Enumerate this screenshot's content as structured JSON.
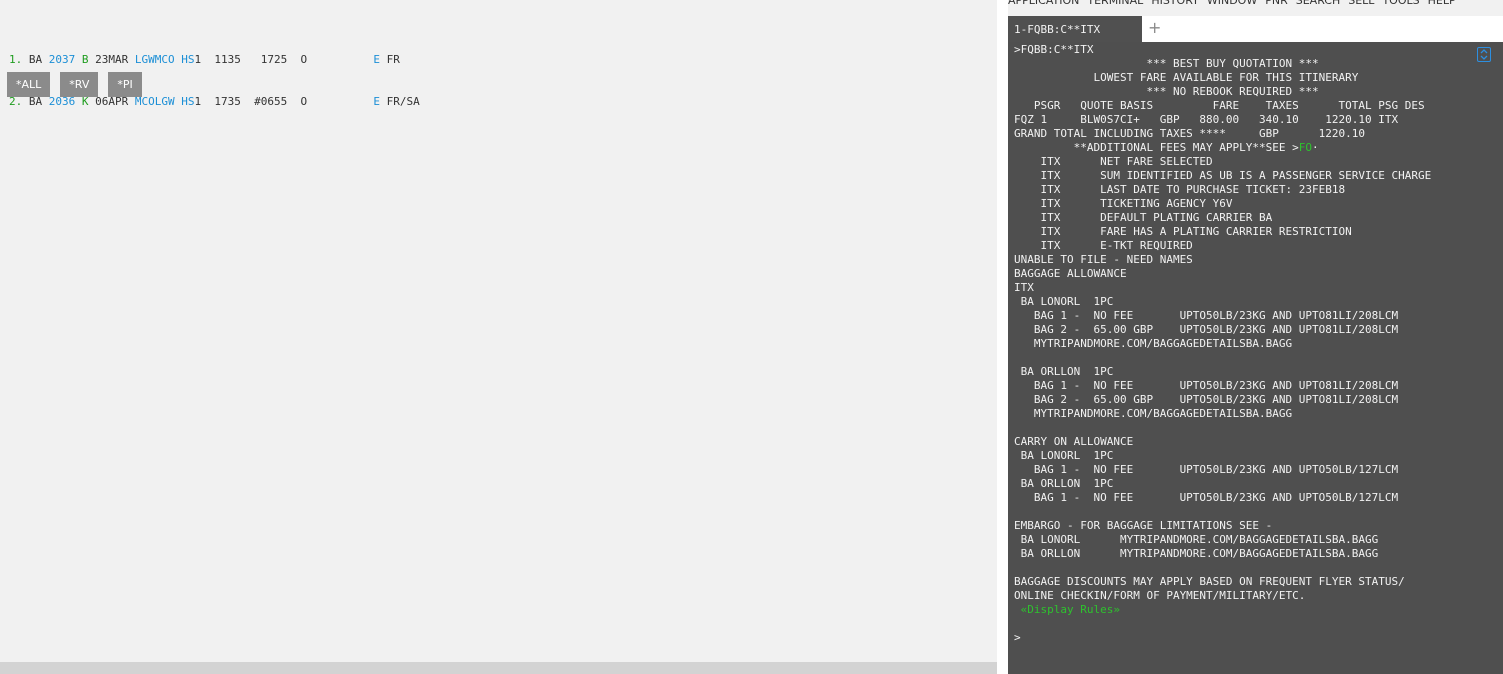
{
  "menubar": [
    "APPLICATION",
    "TERMINAL",
    "HISTORY",
    "WINDOW",
    "PNR",
    "SEARCH",
    "SELL",
    "TOOLS",
    "HELP"
  ],
  "itinerary": [
    {
      "num": "1.",
      "airline": "BA",
      "flight": "2037",
      "class": "B",
      "date": "23MAR",
      "route": "LGWMCO",
      "status": "HS",
      "qty": "1",
      "dep": "1135",
      "arr": "1725",
      "flag": "O",
      "eticket": "E",
      "days": "FR"
    },
    {
      "num": "2.",
      "airline": "BA",
      "flight": "2036",
      "class": "K",
      "date": "06APR",
      "route": "MCOLGW",
      "status": "HS",
      "qty": "1",
      "dep": "1735",
      "arr": "#0655",
      "flag": "O",
      "eticket": "E",
      "days": "FR/SA"
    }
  ],
  "quick_buttons": [
    "*ALL",
    "*RV",
    "*PI"
  ],
  "tab": {
    "label": "1-FQBB:C**ITX",
    "add": "+"
  },
  "terminal": {
    "lines": [
      ">FQBB:C**ITX",
      "                    *** BEST BUY QUOTATION ***",
      "            LOWEST FARE AVAILABLE FOR THIS ITINERARY",
      "                    *** NO REBOOK REQUIRED ***",
      "   PSGR   QUOTE BASIS         FARE    TAXES      TOTAL PSG DES",
      "FQZ 1     BLW0S7CI+   GBP   880.00   340.10    1220.10 ITX",
      "GRAND TOTAL INCLUDING TAXES ****     GBP      1220.10",
      "",
      "    ITX      NET FARE SELECTED",
      "    ITX      SUM IDENTIFIED AS UB IS A PASSENGER SERVICE CHARGE",
      "    ITX      LAST DATE TO PURCHASE TICKET: 23FEB18",
      "    ITX      TICKETING AGENCY Y6V",
      "    ITX      DEFAULT PLATING CARRIER BA",
      "    ITX      FARE HAS A PLATING CARRIER RESTRICTION",
      "    ITX      E-TKT REQUIRED",
      "UNABLE TO FILE - NEED NAMES",
      "BAGGAGE ALLOWANCE",
      "ITX",
      " BA LONORL  1PC",
      "   BAG 1 -  NO FEE       UPTO50LB/23KG AND UPTO81LI/208LCM",
      "   BAG 2 -  65.00 GBP    UPTO50LB/23KG AND UPTO81LI/208LCM",
      "   MYTRIPANDMORE.COM/BAGGAGEDETAILSBA.BAGG",
      "",
      " BA ORLLON  1PC",
      "   BAG 1 -  NO FEE       UPTO50LB/23KG AND UPTO81LI/208LCM",
      "   BAG 2 -  65.00 GBP    UPTO50LB/23KG AND UPTO81LI/208LCM",
      "   MYTRIPANDMORE.COM/BAGGAGEDETAILSBA.BAGG",
      "",
      "CARRY ON ALLOWANCE",
      " BA LONORL  1PC",
      "   BAG 1 -  NO FEE       UPTO50LB/23KG AND UPTO50LB/127LCM",
      " BA ORLLON  1PC",
      "   BAG 1 -  NO FEE       UPTO50LB/23KG AND UPTO50LB/127LCM",
      "",
      "EMBARGO - FOR BAGGAGE LIMITATIONS SEE -",
      " BA LONORL      MYTRIPANDMORE.COM/BAGGAGEDETAILSBA.BAGG",
      " BA ORLLON      MYTRIPANDMORE.COM/BAGGAGEDETAILSBA.BAGG",
      "",
      "BAGGAGE DISCOUNTS MAY APPLY BASED ON FREQUENT FLYER STATUS/",
      "ONLINE CHECKIN/FORM OF PAYMENT/MILITARY/ETC."
    ],
    "fees_prefix": "         **ADDITIONAL FEES MAY APPLY**SEE >",
    "fees_link": "FO",
    "fees_suffix": "·",
    "display_rules": " «Display Rules»",
    "prompt": ">"
  }
}
